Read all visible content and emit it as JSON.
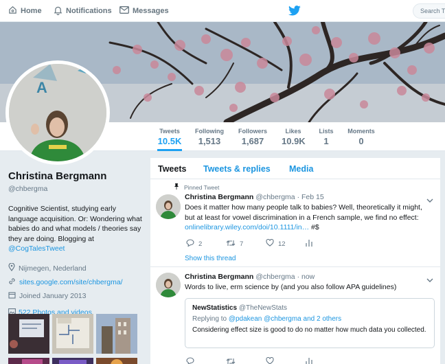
{
  "nav": {
    "home": "Home",
    "notifications": "Notifications",
    "messages": "Messages",
    "search_placeholder": "Search Tw"
  },
  "stats": [
    {
      "label": "Tweets",
      "value": "10.5K"
    },
    {
      "label": "Following",
      "value": "1,513"
    },
    {
      "label": "Followers",
      "value": "1,687"
    },
    {
      "label": "Likes",
      "value": "10.9K"
    },
    {
      "label": "Lists",
      "value": "1"
    },
    {
      "label": "Moments",
      "value": "0"
    }
  ],
  "profile": {
    "name": "Christina Bergmann",
    "handle": "@chbergma",
    "bio": "Cognitive Scientist, studying early language acquisition. Or: Wondering what babies do and what models / theories say they are doing. Blogging at",
    "bio_link": "@CogTalesTweet",
    "location": "Nijmegen, Nederland",
    "website": "sites.google.com/site/chbergma/",
    "joined": "Joined January 2013",
    "photos": "522 Photos and videos"
  },
  "tabs": [
    "Tweets",
    "Tweets & replies",
    "Media"
  ],
  "tweets": [
    {
      "pinned": "Pinned Tweet",
      "name": "Christina Bergmann",
      "handle": "@chbergma",
      "sep": "·",
      "time": "Feb 15",
      "text": "Does it matter how many people talk to babies? Well, theoretically it might, but at least for vowel discrimination in a French sample, we find no effect:",
      "link": "onlinelibrary.wiley.com/doi/10.1111/in…",
      "tags": " #$",
      "replies": "2",
      "retweets": "7",
      "likes": "12",
      "thread": "Show this thread"
    },
    {
      "name": "Christina Bergmann",
      "handle": "@chbergma",
      "sep": "·",
      "time": "now",
      "text": "Words to live, erm science by (and you also follow APA guidelines)",
      "quote": {
        "name": "NewStatistics",
        "handle": "@TheNewStats",
        "reply_prefix": "Replying to",
        "reply_users": "@pdakean @chbergma",
        "reply_suffix": "and 2 others",
        "text": "Considering effect size is good to do no matter how much data you collected."
      }
    }
  ],
  "colors": {
    "accent": "#1da1f2",
    "link": "#1b95e0",
    "muted": "#657786",
    "background": "#e6ecf0"
  }
}
